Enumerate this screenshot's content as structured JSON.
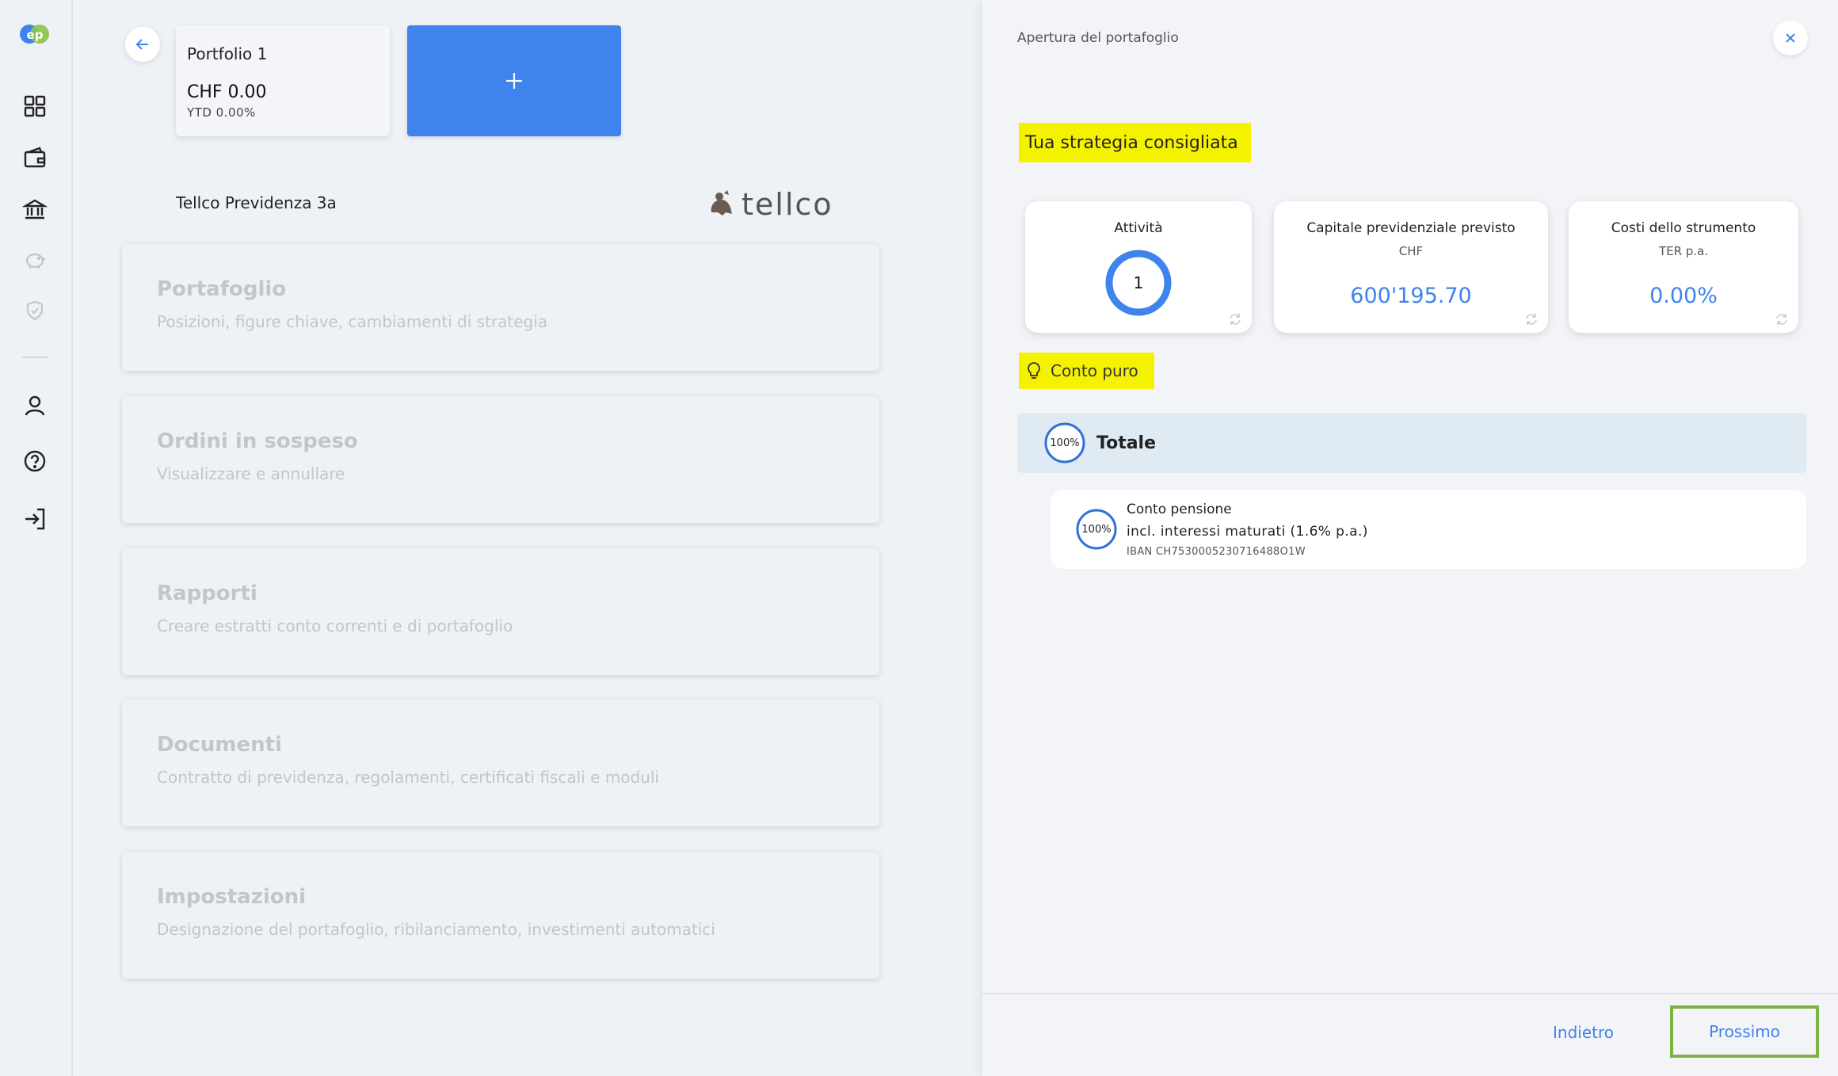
{
  "sidebar": {
    "logo_text": "ep",
    "items": [
      {
        "icon": "dashboard-icon"
      },
      {
        "icon": "wallet-icon"
      },
      {
        "icon": "bank-icon"
      },
      {
        "icon": "piggy-bank-icon"
      },
      {
        "icon": "shield-icon"
      },
      {
        "icon": "user-icon"
      },
      {
        "icon": "help-icon"
      },
      {
        "icon": "logout-icon"
      }
    ]
  },
  "portfolio": {
    "name": "Portfolio 1",
    "value": "CHF 0.00",
    "ytd": "YTD 0.00%",
    "add_label": "+"
  },
  "provider": {
    "name": "Tellco Previdenza 3a",
    "brand": "tellco"
  },
  "menu": [
    {
      "title": "Portafoglio",
      "subtitle": "Posizioni, figure chiave, cambiamenti di strategia"
    },
    {
      "title": "Ordini in sospeso",
      "subtitle": "Visualizzare e annullare"
    },
    {
      "title": "Rapporti",
      "subtitle": "Creare estratti conto correnti e di portafoglio"
    },
    {
      "title": "Documenti",
      "subtitle": "Contratto di previdenza, regolamenti, certificati fiscali e moduli"
    },
    {
      "title": "Impostazioni",
      "subtitle": "Designazione del portafoglio, ribilanciamento, investimenti automatici"
    }
  ],
  "panel": {
    "title": "Apertura del portafoglio",
    "strategy_label": "Tua strategia consigliata",
    "stats": {
      "activity": {
        "title": "Attività",
        "value": "1"
      },
      "capital": {
        "title": "Capitale previdenziale previsto",
        "unit": "CHF",
        "value": "600'195.70"
      },
      "costs": {
        "title": "Costi dello strumento",
        "unit": "TER p.a.",
        "value": "0.00%"
      }
    },
    "conto_label": "Conto puro",
    "total": {
      "percent": "100%",
      "label": "Totale"
    },
    "account": {
      "percent": "100%",
      "name": "Conto pensione",
      "interest": "incl. interessi maturati (1.6% p.a.)",
      "iban": "IBAN CH7530005230716488O1W"
    },
    "footer": {
      "back_label": "Indietro",
      "next_label": "Prossimo"
    }
  },
  "colors": {
    "accent": "#3f83ec",
    "highlight": "#f5f200",
    "focus": "#7cb342"
  }
}
